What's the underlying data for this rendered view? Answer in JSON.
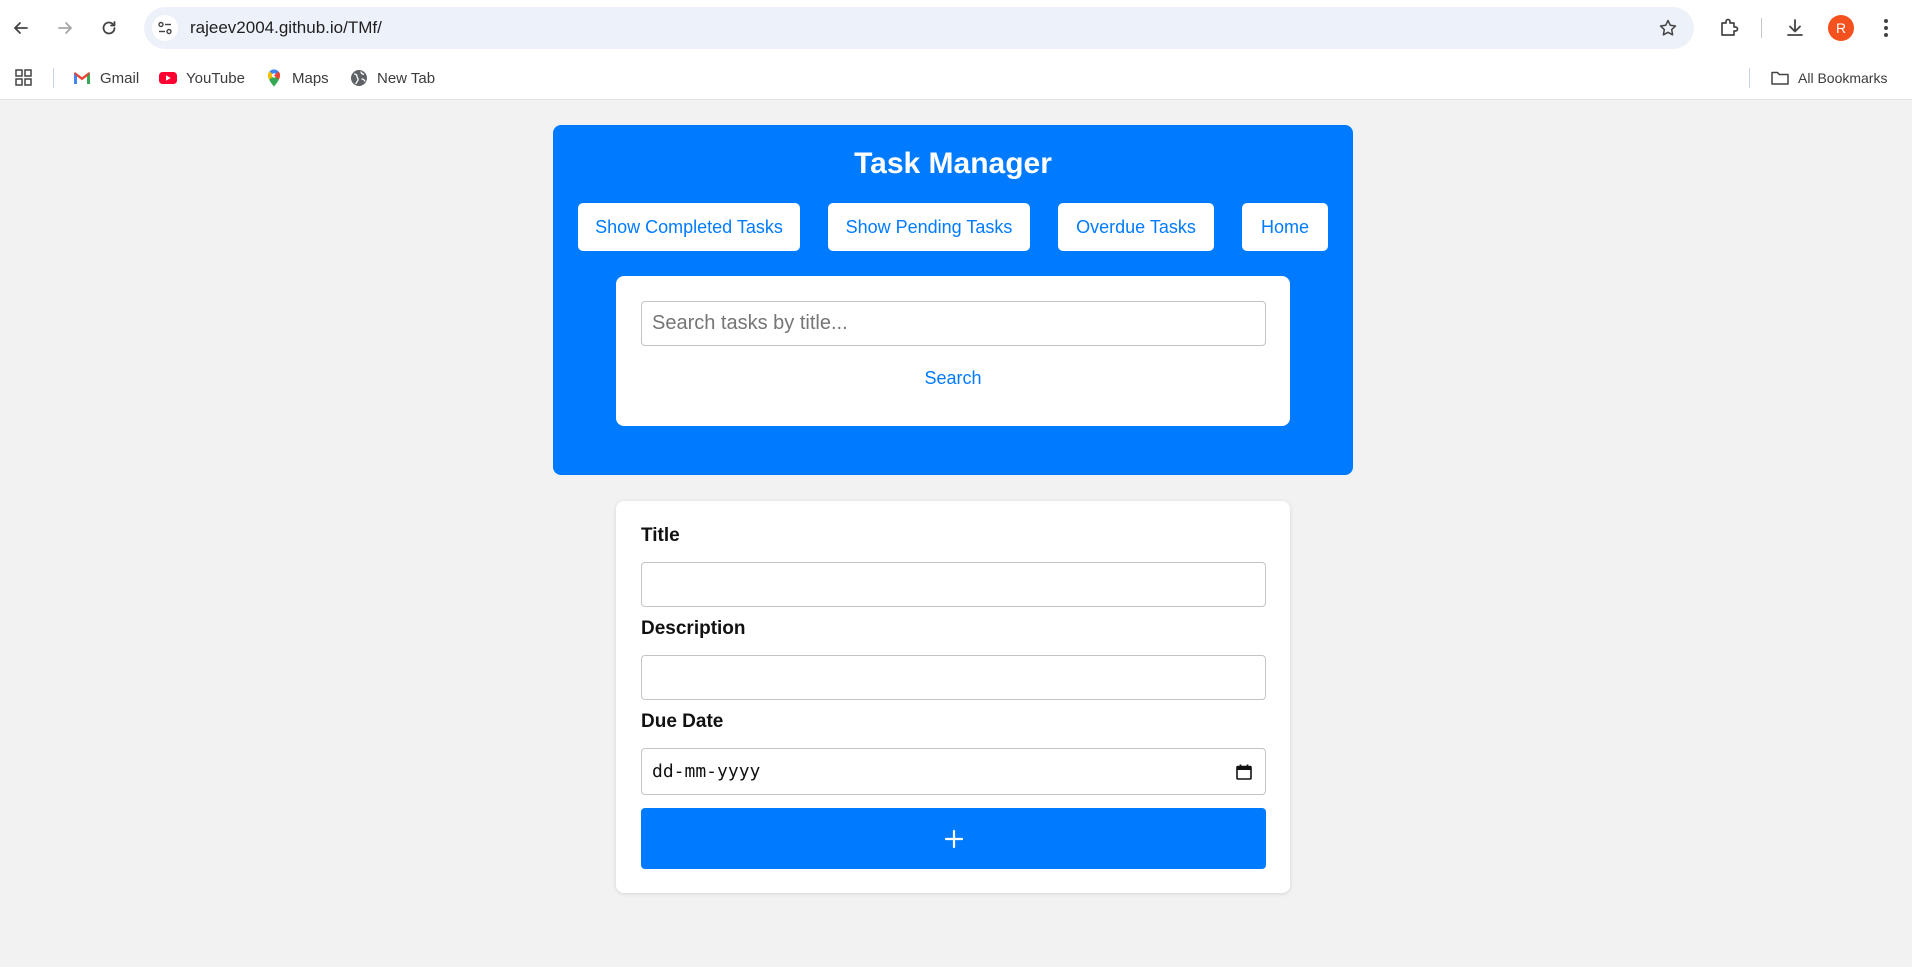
{
  "browser": {
    "url": "rajeev2004.github.io/TMf/",
    "profile_initial": "R",
    "bookmarks": [
      {
        "label": "Gmail",
        "icon": "gmail-icon"
      },
      {
        "label": "YouTube",
        "icon": "youtube-icon"
      },
      {
        "label": "Maps",
        "icon": "maps-icon"
      },
      {
        "label": "New Tab",
        "icon": "globe-icon"
      }
    ],
    "all_bookmarks_label": "All Bookmarks"
  },
  "app": {
    "title": "Task Manager",
    "accent_color": "#007bff",
    "nav": [
      {
        "label": "Show Completed Tasks"
      },
      {
        "label": "Show Pending Tasks"
      },
      {
        "label": "Overdue Tasks"
      },
      {
        "label": "Home"
      }
    ],
    "search": {
      "placeholder": "Search tasks by title...",
      "value": "",
      "button_label": "Search"
    },
    "form": {
      "title_label": "Title",
      "title_value": "",
      "description_label": "Description",
      "description_value": "",
      "due_date_label": "Due Date",
      "due_date_placeholder": "dd-mm-yyyy",
      "add_button_icon": "plus-icon"
    }
  }
}
